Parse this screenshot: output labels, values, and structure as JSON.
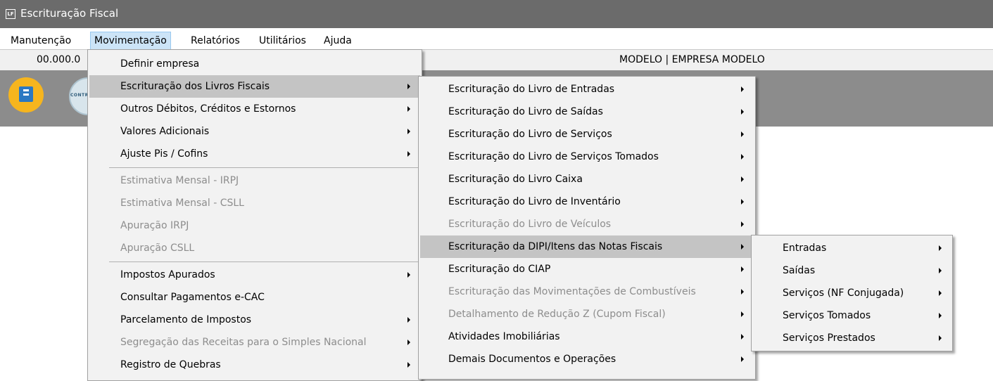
{
  "window": {
    "icon_text": "LF",
    "title": "Escrituração Fiscal"
  },
  "menubar": {
    "items": [
      {
        "label": "Manutenção"
      },
      {
        "label": "Movimentação"
      },
      {
        "label": "Relatórios"
      },
      {
        "label": "Utilitários"
      },
      {
        "label": "Ajuda"
      }
    ]
  },
  "infobar": {
    "code": "00.000.0",
    "company": "MODELO | EMPRESA MODELO"
  },
  "toolbar": {
    "contract_icon_text": "CONTR"
  },
  "movimentacao_menu": {
    "items": [
      {
        "label": "Definir empresa",
        "submenu": false,
        "enabled": true
      },
      {
        "label": "Escrituração dos Livros Fiscais",
        "submenu": true,
        "enabled": true,
        "highlighted": true
      },
      {
        "label": "Outros Débitos, Créditos e Estornos",
        "submenu": true,
        "enabled": true
      },
      {
        "label": "Valores Adicionais",
        "submenu": true,
        "enabled": true
      },
      {
        "label": "Ajuste Pis / Cofins",
        "submenu": true,
        "enabled": true
      },
      {
        "label": "Estimativa Mensal - IRPJ",
        "submenu": false,
        "enabled": false
      },
      {
        "label": "Estimativa Mensal - CSLL",
        "submenu": false,
        "enabled": false
      },
      {
        "label": "Apuração IRPJ",
        "submenu": false,
        "enabled": false
      },
      {
        "label": "Apuração CSLL",
        "submenu": false,
        "enabled": false
      },
      {
        "label": "Impostos Apurados",
        "submenu": true,
        "enabled": true
      },
      {
        "label": "Consultar Pagamentos e-CAC",
        "submenu": false,
        "enabled": true
      },
      {
        "label": "Parcelamento de Impostos",
        "submenu": true,
        "enabled": true
      },
      {
        "label": "Segregação das Receitas para o Simples Nacional",
        "submenu": true,
        "enabled": false
      },
      {
        "label": "Registro de Quebras",
        "submenu": true,
        "enabled": true
      }
    ]
  },
  "livros_menu": {
    "items": [
      {
        "label": "Escrituração do Livro de Entradas",
        "submenu": true,
        "enabled": true
      },
      {
        "label": "Escrituração do Livro de Saídas",
        "submenu": true,
        "enabled": true
      },
      {
        "label": "Escrituração do Livro de Serviços",
        "submenu": true,
        "enabled": true
      },
      {
        "label": "Escrituração do Livro de Serviços Tomados",
        "submenu": true,
        "enabled": true
      },
      {
        "label": "Escrituração do Livro Caixa",
        "submenu": true,
        "enabled": true
      },
      {
        "label": "Escrituração do Livro de Inventário",
        "submenu": true,
        "enabled": true
      },
      {
        "label": "Escrituração do Livro de Veículos",
        "submenu": true,
        "enabled": false
      },
      {
        "label": "Escrituração da DIPI/Itens das Notas Fiscais",
        "submenu": true,
        "enabled": true,
        "highlighted": true
      },
      {
        "label": "Escrituração do CIAP",
        "submenu": true,
        "enabled": true
      },
      {
        "label": "Escrituração das Movimentações de Combustíveis",
        "submenu": true,
        "enabled": false
      },
      {
        "label": "Detalhamento de Redução Z (Cupom Fiscal)",
        "submenu": true,
        "enabled": false
      },
      {
        "label": "Atividades Imobiliárias",
        "submenu": true,
        "enabled": true
      },
      {
        "label": "Demais Documentos e Operações",
        "submenu": true,
        "enabled": true
      }
    ]
  },
  "dipi_menu": {
    "items": [
      {
        "label": "Entradas",
        "submenu": true,
        "enabled": true
      },
      {
        "label": "Saídas",
        "submenu": true,
        "enabled": true
      },
      {
        "label": "Serviços (NF Conjugada)",
        "submenu": true,
        "enabled": true
      },
      {
        "label": "Serviços Tomados",
        "submenu": true,
        "enabled": true
      },
      {
        "label": "Serviços Prestados",
        "submenu": true,
        "enabled": true
      }
    ]
  }
}
